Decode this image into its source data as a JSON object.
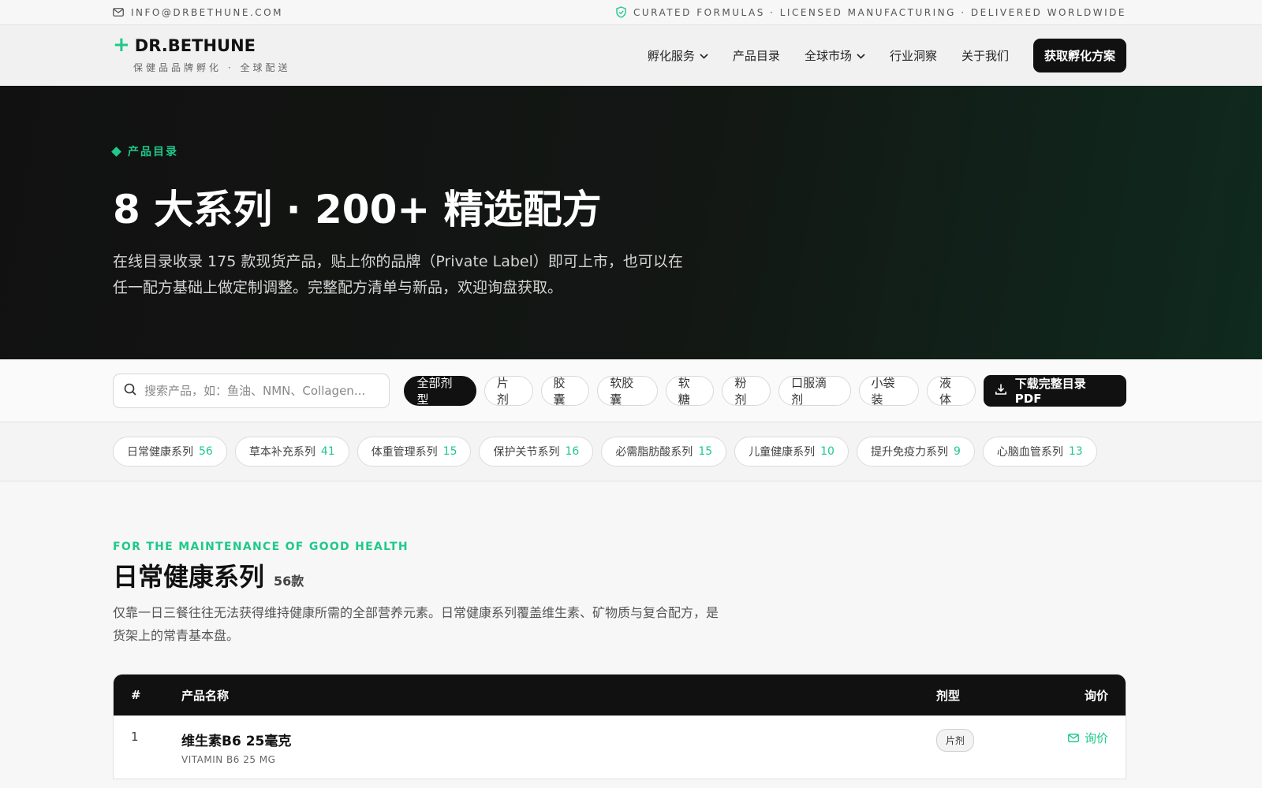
{
  "topbar": {
    "email": "INFO@DRBETHUNE.COM",
    "tagline": "CURATED FORMULAS · LICENSED MANUFACTURING · DELIVERED WORLDWIDE"
  },
  "header": {
    "brand": "DR.BETHUNE",
    "brand_tag": "保健品品牌孵化 · 全球配送",
    "nav": [
      {
        "label": "孵化服务",
        "dropdown": true
      },
      {
        "label": "产品目录",
        "dropdown": false
      },
      {
        "label": "全球市场",
        "dropdown": true
      },
      {
        "label": "行业洞察",
        "dropdown": false
      },
      {
        "label": "关于我们",
        "dropdown": false
      }
    ],
    "cta": "获取孵化方案"
  },
  "hero": {
    "eyebrow": "产品目录",
    "title": "8 大系列 · 200+ 精选配方",
    "desc_line1": "在线目录收录 175 款现货产品，贴上你的品牌（Private Label）即可上市，也可以在",
    "desc_line2": "任一配方基础上做定制调整。完整配方清单与新品，欢迎询盘获取。"
  },
  "filters": {
    "search_placeholder": "搜索产品，如：鱼油、NMN、Collagen...",
    "chips": [
      "全部剂型",
      "片剂",
      "胶囊",
      "软胶囊",
      "软糖",
      "粉剂",
      "口服滴剂",
      "小袋装",
      "液体"
    ],
    "active_chip": 0,
    "download": "下载完整目录 PDF"
  },
  "series": [
    {
      "name": "日常健康系列",
      "count": "56"
    },
    {
      "name": "草本补充系列",
      "count": "41"
    },
    {
      "name": "体重管理系列",
      "count": "15"
    },
    {
      "name": "保护关节系列",
      "count": "16"
    },
    {
      "name": "必需脂肪酸系列",
      "count": "15"
    },
    {
      "name": "儿童健康系列",
      "count": "10"
    },
    {
      "name": "提升免疫力系列",
      "count": "9"
    },
    {
      "name": "心脑血管系列",
      "count": "13"
    }
  ],
  "section": {
    "eyebrow": "FOR THE MAINTENANCE OF GOOD HEALTH",
    "title": "日常健康系列",
    "count": "56款",
    "desc_line1": "仅靠一日三餐往往无法获得维持健康所需的全部营养元素。日常健康系列覆盖维生素、矿物质与复合配方，是",
    "desc_line2": "货架上的常青基本盘。"
  },
  "table": {
    "headers": {
      "num": "#",
      "name": "产品名称",
      "type": "剂型",
      "ask": "询价"
    },
    "rows": [
      {
        "num": "1",
        "name": "维生素B6 25毫克",
        "name_en": "VITAMIN B6 25 MG",
        "type": "片剂",
        "ask": "询价"
      }
    ]
  },
  "colors": {
    "accent": "#1fc98a",
    "dark": "#111111"
  }
}
